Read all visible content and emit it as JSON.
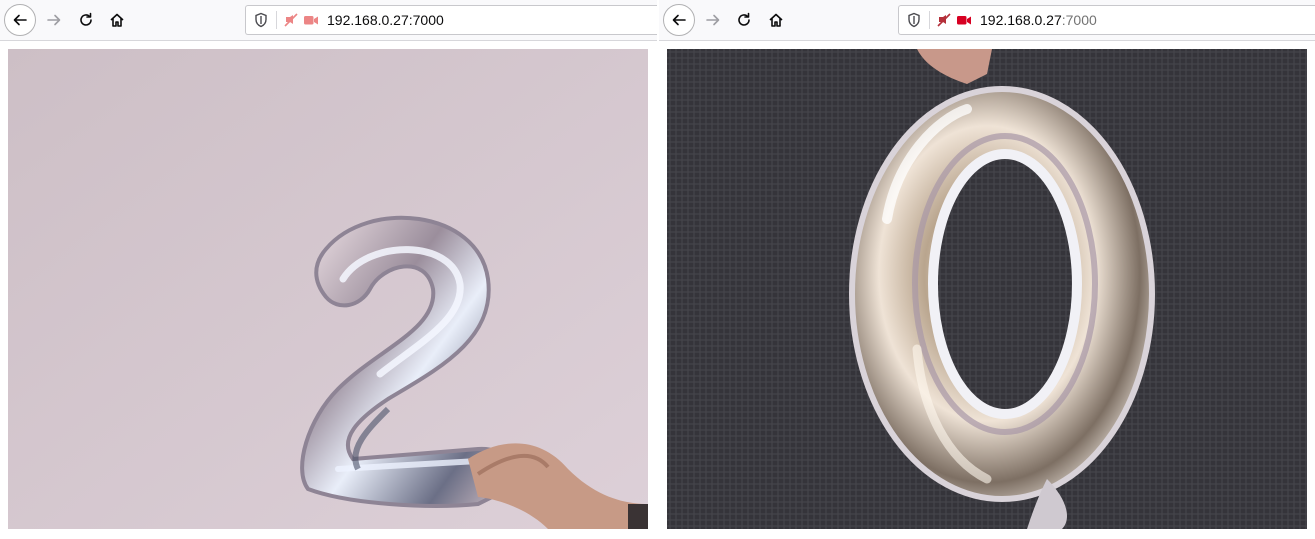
{
  "windows": [
    {
      "nav": {
        "back_icon": "arrow-left-icon",
        "forward_icon": "arrow-right-icon",
        "reload_icon": "reload-icon",
        "home_icon": "home-icon"
      },
      "urlbar": {
        "shield_icon": "tracking-shield-icon",
        "permission_icon": "blocked-permission-icon",
        "camera_icon": "camera-icon",
        "host": "192.168.0.27",
        "port": ":7000"
      },
      "video": {
        "subject": "balloon-digit-2"
      }
    },
    {
      "nav": {
        "back_icon": "arrow-left-icon",
        "forward_icon": "arrow-right-icon",
        "reload_icon": "reload-icon",
        "home_icon": "home-icon"
      },
      "urlbar": {
        "shield_icon": "tracking-shield-icon",
        "permission_icon": "blocked-permission-icon",
        "camera_icon": "camera-icon",
        "host": "192.168.0.27",
        "port": ":7000"
      },
      "video": {
        "subject": "balloon-digit-0"
      }
    }
  ],
  "colors": {
    "toolbar_bg": "#f9f9fb",
    "camera_active_left": "#ec8585",
    "camera_active_right": "#d70022"
  }
}
